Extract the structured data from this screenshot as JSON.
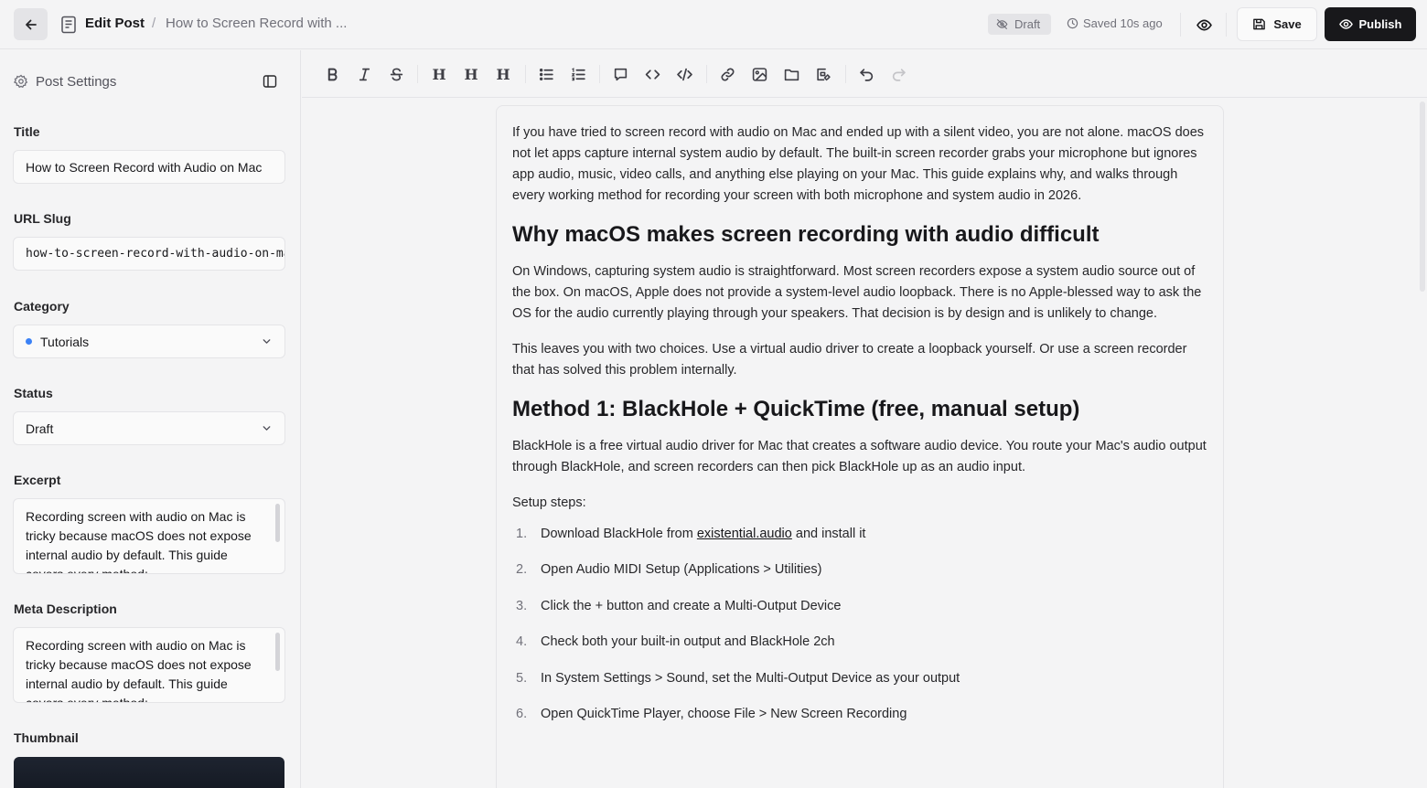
{
  "header": {
    "edit_label": "Edit Post",
    "separator": "/",
    "post_title_short": "How to Screen Record with ...",
    "status_badge": "Draft",
    "saved_text": "Saved 10s ago",
    "save_label": "Save",
    "publish_label": "Publish"
  },
  "sidebar": {
    "heading": "Post Settings",
    "title_label": "Title",
    "title_value": "How to Screen Record with Audio on Mac",
    "slug_label": "URL Slug",
    "slug_value": "how-to-screen-record-with-audio-on-mac",
    "category_label": "Category",
    "category_value": "Tutorials",
    "category_color": "#3b82f6",
    "status_label": "Status",
    "status_value": "Draft",
    "excerpt_label": "Excerpt",
    "excerpt_value": "Recording screen with audio on Mac is tricky because macOS does not expose internal audio by default. This guide covers every method:",
    "meta_label": "Meta Description",
    "meta_value": "Recording screen with audio on Mac is tricky because macOS does not expose internal audio by default. This guide covers every method:",
    "thumbnail_label": "Thumbnail"
  },
  "toolbar": {
    "heading_1": "H",
    "heading_2": "H",
    "heading_3": "H"
  },
  "content": {
    "intro": "If you have tried to screen record with audio on Mac and ended up with a silent video, you are not alone. macOS does not let apps capture internal system audio by default. The built-in screen recorder grabs your microphone but ignores app audio, music, video calls, and anything else playing on your Mac. This guide explains why, and walks through every working method for recording your screen with both microphone and system audio in 2026.",
    "h2_1": "Why macOS makes screen recording with audio difficult",
    "p2": "On Windows, capturing system audio is straightforward. Most screen recorders expose a system audio source out of the box. On macOS, Apple does not provide a system-level audio loopback. There is no Apple-blessed way to ask the OS for the audio currently playing through your speakers. That decision is by design and is unlikely to change.",
    "p3": "This leaves you with two choices. Use a virtual audio driver to create a loopback yourself. Or use a screen recorder that has solved this problem internally.",
    "h2_2": "Method 1: BlackHole + QuickTime (free, manual setup)",
    "p4": "BlackHole is a free virtual audio driver for Mac that creates a software audio device. You route your Mac's audio output through BlackHole, and screen recorders can then pick BlackHole up as an audio input.",
    "p5": "Setup steps:",
    "steps": [
      {
        "num": "1.",
        "before": "Download BlackHole from ",
        "link": "existential.audio",
        "after": " and install it"
      },
      {
        "num": "2.",
        "before": "Open Audio MIDI Setup (Applications > Utilities)",
        "link": "",
        "after": ""
      },
      {
        "num": "3.",
        "before": "Click the + button and create a Multi-Output Device",
        "link": "",
        "after": ""
      },
      {
        "num": "4.",
        "before": "Check both your built-in output and BlackHole 2ch",
        "link": "",
        "after": ""
      },
      {
        "num": "5.",
        "before": "In System Settings > Sound, set the Multi-Output Device as your output",
        "link": "",
        "after": ""
      },
      {
        "num": "6.",
        "before": "Open QuickTime Player, choose File > New Screen Recording",
        "link": "",
        "after": ""
      }
    ]
  }
}
